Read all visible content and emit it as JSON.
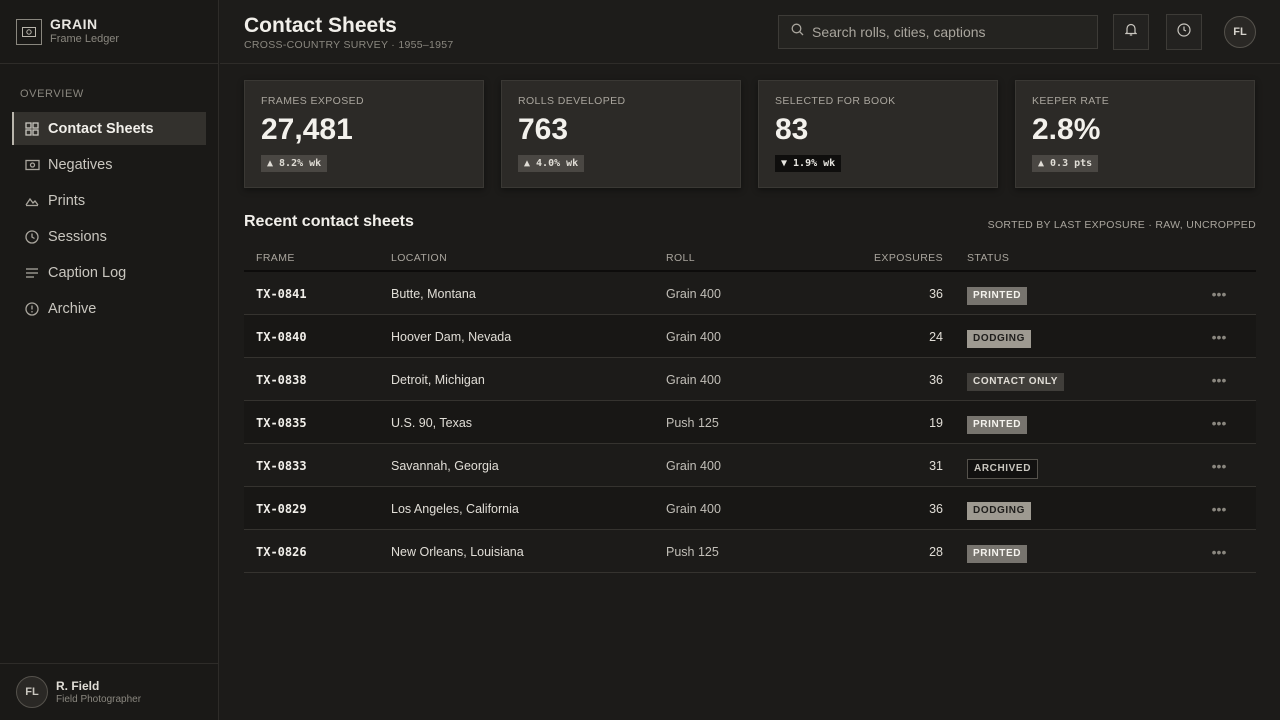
{
  "brand": {
    "name": "GRAIN",
    "subtitle": "Frame Ledger",
    "icon": "camera-icon"
  },
  "sidebar": {
    "section_label": "OVERVIEW",
    "items": [
      {
        "label": "Contact Sheets",
        "icon": "grid-icon",
        "active": true
      },
      {
        "label": "Negatives",
        "icon": "film-icon"
      },
      {
        "label": "Prints",
        "icon": "mountain-icon"
      },
      {
        "label": "Sessions",
        "icon": "clock-icon"
      },
      {
        "label": "Caption Log",
        "icon": "lines-icon"
      },
      {
        "label": "Archive",
        "icon": "archive-icon"
      }
    ],
    "user": {
      "initials": "FL",
      "name": "R. Field",
      "role": "Field Photographer"
    }
  },
  "header": {
    "title": "Contact Sheets",
    "subtitle": "CROSS-COUNTRY SURVEY · 1955–1957",
    "search_placeholder": "Search rolls, cities, captions",
    "avatar_initials": "FL"
  },
  "stats": [
    {
      "label": "FRAMES EXPOSED",
      "value": "27,481",
      "delta": "▲ 8.2% wk",
      "direction": "up"
    },
    {
      "label": "ROLLS DEVELOPED",
      "value": "763",
      "delta": "▲ 4.0% wk",
      "direction": "up"
    },
    {
      "label": "SELECTED FOR BOOK",
      "value": "83",
      "delta": "▼ 1.9% wk",
      "direction": "down"
    },
    {
      "label": "KEEPER RATE",
      "value": "2.8%",
      "delta": "▲ 0.3 pts",
      "direction": "up"
    }
  ],
  "table": {
    "title": "Recent contact sheets",
    "meta": "SORTED BY LAST EXPOSURE · RAW, UNCROPPED",
    "columns": [
      "FRAME",
      "LOCATION",
      "ROLL",
      "EXPOSURES",
      "STATUS"
    ],
    "rows": [
      {
        "frame": "TX-0841",
        "location": "Butte, Montana",
        "roll": "Grain 400",
        "exposures": "36",
        "status": "PRINTED"
      },
      {
        "frame": "TX-0840",
        "location": "Hoover Dam, Nevada",
        "roll": "Grain 400",
        "exposures": "24",
        "status": "DODGING"
      },
      {
        "frame": "TX-0838",
        "location": "Detroit, Michigan",
        "roll": "Grain 400",
        "exposures": "36",
        "status": "CONTACT ONLY"
      },
      {
        "frame": "TX-0835",
        "location": "U.S. 90, Texas",
        "roll": "Push 125",
        "exposures": "19",
        "status": "PRINTED"
      },
      {
        "frame": "TX-0833",
        "location": "Savannah, Georgia",
        "roll": "Grain 400",
        "exposures": "31",
        "status": "ARCHIVED"
      },
      {
        "frame": "TX-0829",
        "location": "Los Angeles, California",
        "roll": "Grain 400",
        "exposures": "36",
        "status": "DODGING"
      },
      {
        "frame": "TX-0826",
        "location": "New Orleans, Louisiana",
        "roll": "Push 125",
        "exposures": "28",
        "status": "PRINTED"
      }
    ]
  }
}
